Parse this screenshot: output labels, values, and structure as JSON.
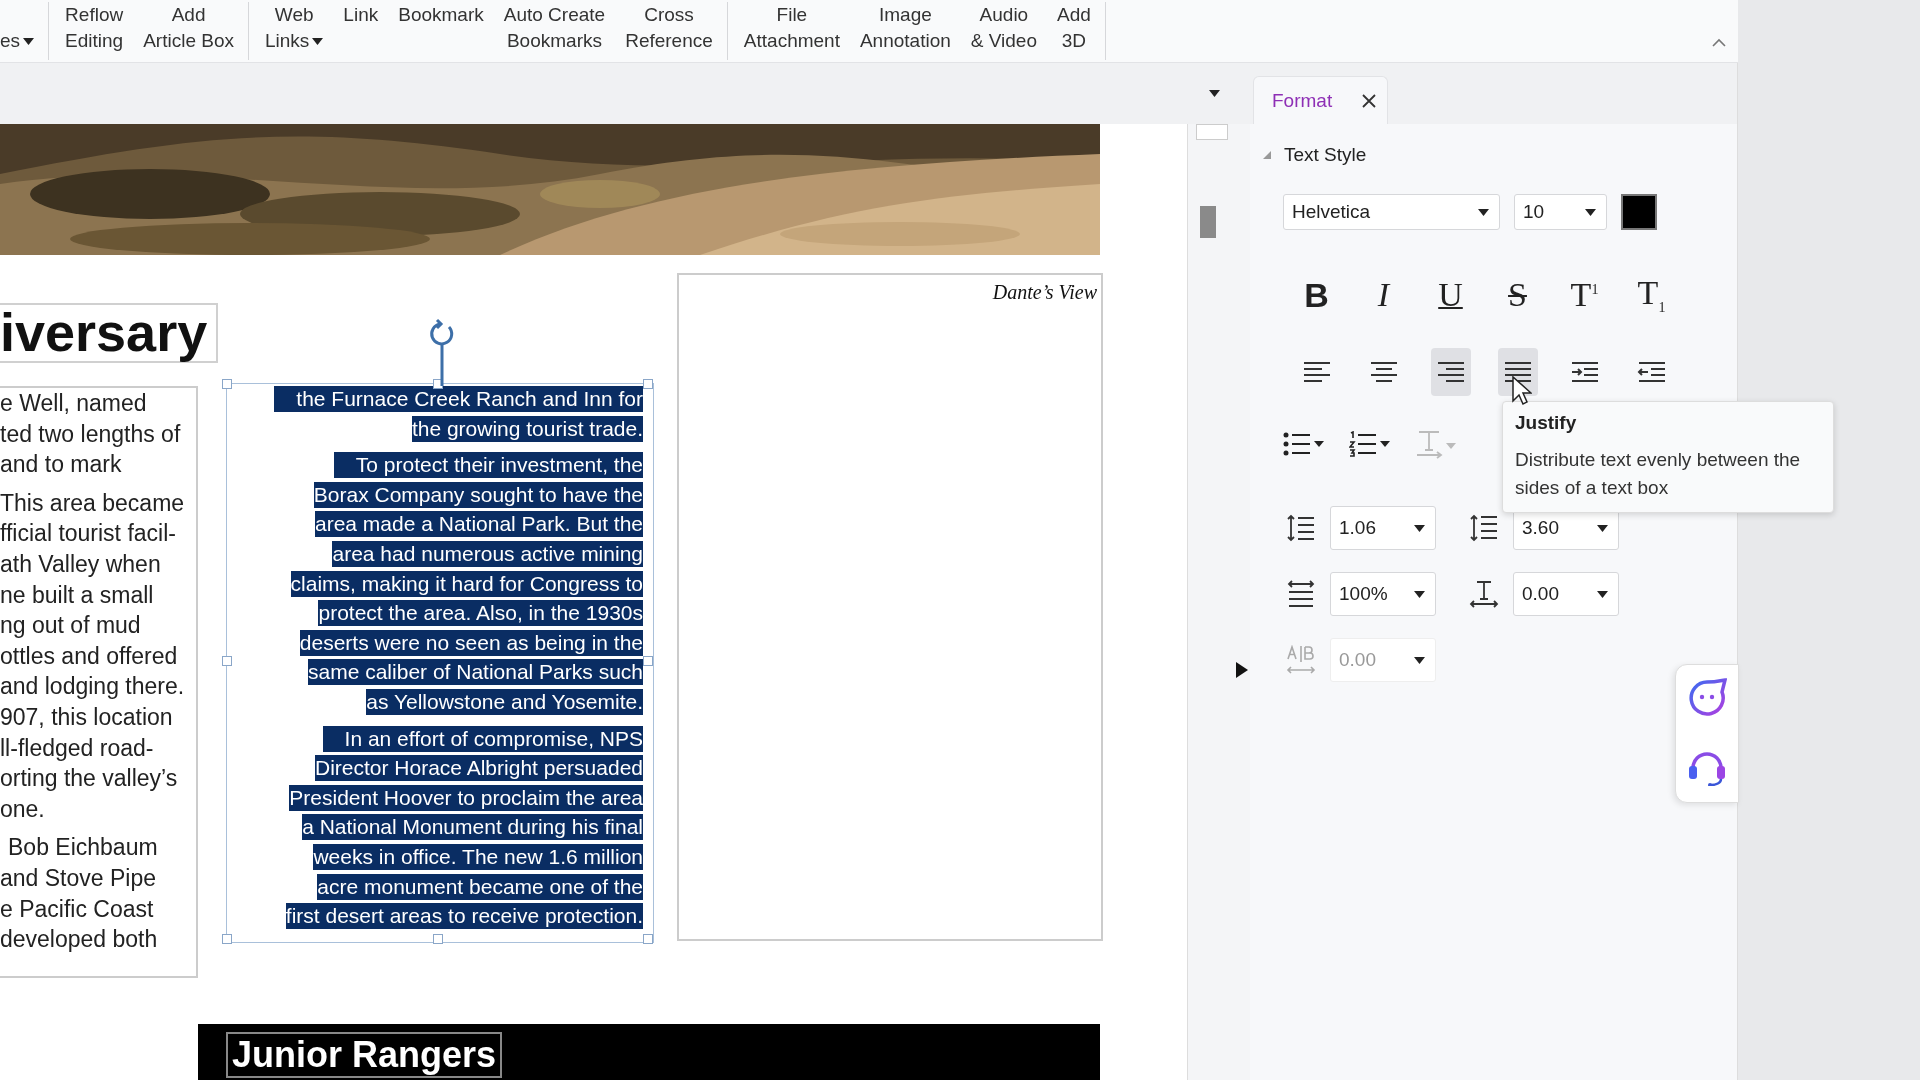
{
  "ribbon": {
    "items": [
      {
        "bottom": "es",
        "dropdown": true,
        "group_end": true
      },
      {
        "top": "Reflow",
        "bottom": "Editing",
        "dropdown": false,
        "group_end": false
      },
      {
        "top": "Add",
        "bottom": "Article Box",
        "dropdown": false,
        "group_end": true
      },
      {
        "top": "Web",
        "bottom": "Links",
        "dropdown": true,
        "group_end": false
      },
      {
        "top": "Link",
        "dropdown": false,
        "group_end": false
      },
      {
        "top": "Bookmark",
        "dropdown": false,
        "group_end": false
      },
      {
        "top": "Auto Create",
        "bottom": "Bookmarks",
        "dropdown": false,
        "group_end": false
      },
      {
        "top": "Cross",
        "bottom": "Reference",
        "dropdown": false,
        "group_end": true
      },
      {
        "top": "File",
        "bottom": "Attachment",
        "dropdown": false,
        "group_end": false
      },
      {
        "top": "Image",
        "bottom": "Annotation",
        "dropdown": false,
        "group_end": false
      },
      {
        "top": "Audio",
        "bottom": "& Video",
        "dropdown": false,
        "group_end": false
      },
      {
        "top": "Add",
        "bottom": "3D",
        "dropdown": false,
        "group_end": true
      }
    ]
  },
  "document": {
    "heading": "iversary",
    "left_column": [
      {
        "lines": [
          "e Well, named",
          "ted two lengths of",
          "and to mark"
        ]
      },
      {
        "lines": [
          "This area became",
          "fficial tourist facil-",
          "ath Valley when",
          "ne built a small",
          "ng out of mud",
          "ottles and offered",
          "and lodging there.",
          "907, this location",
          "ll-fledged road-",
          "orting the valley’s",
          "one."
        ]
      },
      {
        "lines": [
          "Bob Eichbaum",
          "and Stove Pipe",
          "e Pacific Coast",
          "developed both"
        ]
      }
    ],
    "selected_box": {
      "selected": true,
      "paragraphs": [
        {
          "lines": [
            "the Furnace Creek Ranch and Inn for",
            "the growing tourist trade."
          ]
        },
        {
          "lines": [
            "To protect their investment, the",
            "Borax Company sought to have the",
            "area made a National Park. But the",
            "area had numerous active mining",
            "claims, making it hard for Congress to",
            "protect the area. Also, in the 1930s",
            "deserts were no seen as being in the",
            "same caliber of National Parks such",
            "as Yellowstone and Yosemite."
          ]
        },
        {
          "lines": [
            "In an effort of compromise, NPS",
            "Director Horace Albright persuaded",
            "President Hoover to proclaim the area",
            "a National Monument during his final",
            "weeks in office. The new 1.6 million",
            "acre monument became one of the",
            "first desert areas to receive protection."
          ]
        }
      ]
    },
    "caption": "Dante’s View",
    "banner": "Junior Rangers"
  },
  "format_panel": {
    "tab": {
      "label": "Format",
      "selected": true
    },
    "section": {
      "title": "Text Style",
      "expanded": true
    },
    "font": "Helvetica",
    "size": "10",
    "color": "#000000",
    "style_buttons": [
      {
        "kind": "bold",
        "glyph": "B"
      },
      {
        "kind": "italic",
        "glyph": "I"
      },
      {
        "kind": "underline",
        "glyph": "U"
      },
      {
        "kind": "strike",
        "glyph": "S"
      },
      {
        "kind": "superscript",
        "glyph": "T$^{1}$"
      },
      {
        "kind": "subscript",
        "glyph": "T$_{1}$"
      }
    ],
    "align_buttons": [
      {
        "kind": "left",
        "selected": false
      },
      {
        "kind": "center",
        "selected": false
      },
      {
        "kind": "right",
        "selected": true
      },
      {
        "kind": "justify",
        "selected": true
      },
      {
        "kind": "indent",
        "selected": false
      },
      {
        "kind": "outdent",
        "selected": false
      }
    ],
    "list_buttons": [
      {
        "kind": "bullets",
        "disabled": false
      },
      {
        "kind": "numbers",
        "disabled": false
      },
      {
        "kind": "direction",
        "disabled": true
      }
    ],
    "spacing": [
      {
        "kind": "line",
        "value": "1.06",
        "disabled": false
      },
      {
        "kind": "paragraph",
        "value": "3.60",
        "disabled": false
      },
      {
        "kind": "scale",
        "value": "100%",
        "disabled": false
      },
      {
        "kind": "char",
        "value": "0.00",
        "disabled": false
      },
      {
        "kind": "word",
        "value": "0.00",
        "disabled": true
      }
    ],
    "tooltip": {
      "title": "Justify",
      "text": "Distribute text evenly between the sides of a text box"
    }
  }
}
